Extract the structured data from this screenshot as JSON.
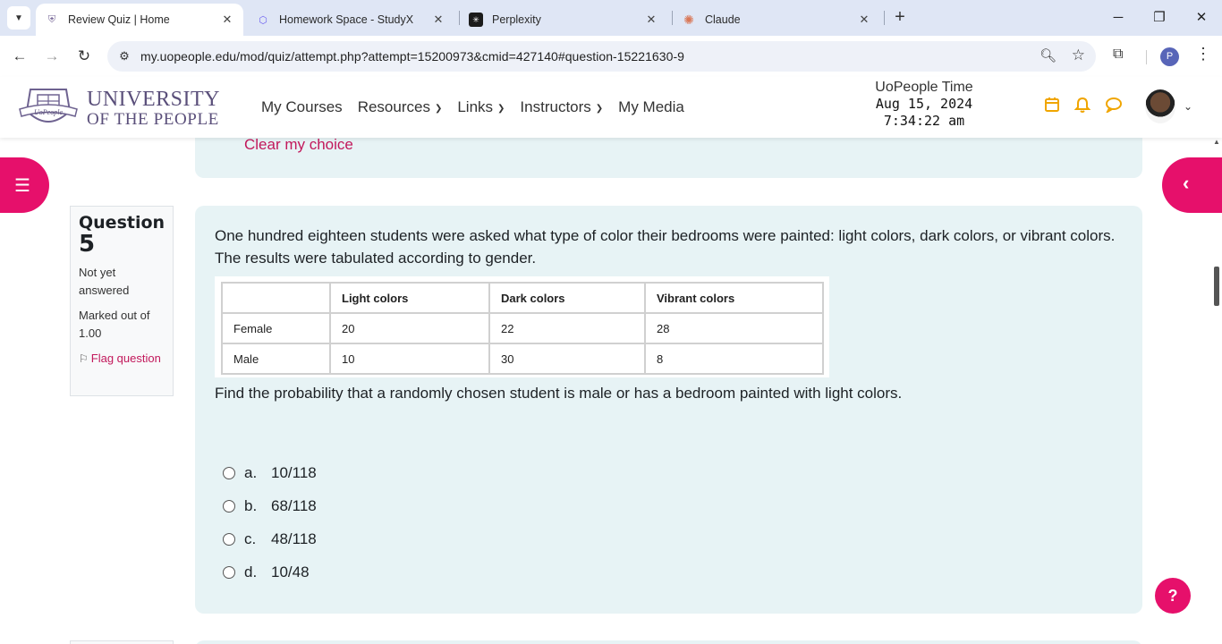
{
  "browser": {
    "tabs": [
      {
        "title": "Review Quiz | Home",
        "icon": "uopeople-favicon",
        "active": true
      },
      {
        "title": "Homework Space - StudyX",
        "icon": "studyx-favicon",
        "active": false
      },
      {
        "title": "Perplexity",
        "icon": "perplexity-favicon",
        "active": false
      },
      {
        "title": "Claude",
        "icon": "claude-favicon",
        "active": false
      }
    ],
    "url": "my.uopeople.edu/mod/quiz/attempt.php?attempt=15200973&cmid=427140#question-15221630-9",
    "profile_initial": "P"
  },
  "site": {
    "logo_line1": "UNIVERSITY",
    "logo_line2": "OF THE PEOPLE",
    "crest_text": "UoPeople",
    "nav": [
      {
        "label": "My Courses",
        "dropdown": false
      },
      {
        "label": "Resources",
        "dropdown": true
      },
      {
        "label": "Links",
        "dropdown": true
      },
      {
        "label": "Instructors",
        "dropdown": true
      },
      {
        "label": "My Media",
        "dropdown": false
      }
    ],
    "time_label": "UoPeople Time",
    "date": "Aug 15, 2024",
    "time": "7:34:22 am",
    "accent_color": "#e6106b",
    "icon_color": "#f0a500"
  },
  "previous_question": {
    "clear_choice": "Clear my choice"
  },
  "question": {
    "title": "Question",
    "number": "5",
    "state": "Not yet answered",
    "grade": "Marked out of 1.00",
    "flag": "Flag question",
    "text": "One hundred eighteen students were asked what type of color their bedrooms were painted: light colors, dark colors, or vibrant colors. The results were tabulated according to gender.",
    "table": {
      "headers": [
        "",
        "Light colors",
        "Dark colors",
        "Vibrant colors"
      ],
      "rows": [
        [
          "Female",
          "20",
          "22",
          "28"
        ],
        [
          "Male",
          "10",
          "30",
          "8"
        ]
      ]
    },
    "prompt": "Find the probability that a randomly chosen student is male or has a bedroom painted with light colors.",
    "options": [
      {
        "letter": "a.",
        "text": "10/118"
      },
      {
        "letter": "b.",
        "text": "68/118"
      },
      {
        "letter": "c.",
        "text": "48/118"
      },
      {
        "letter": "d.",
        "text": "10/48"
      }
    ]
  }
}
